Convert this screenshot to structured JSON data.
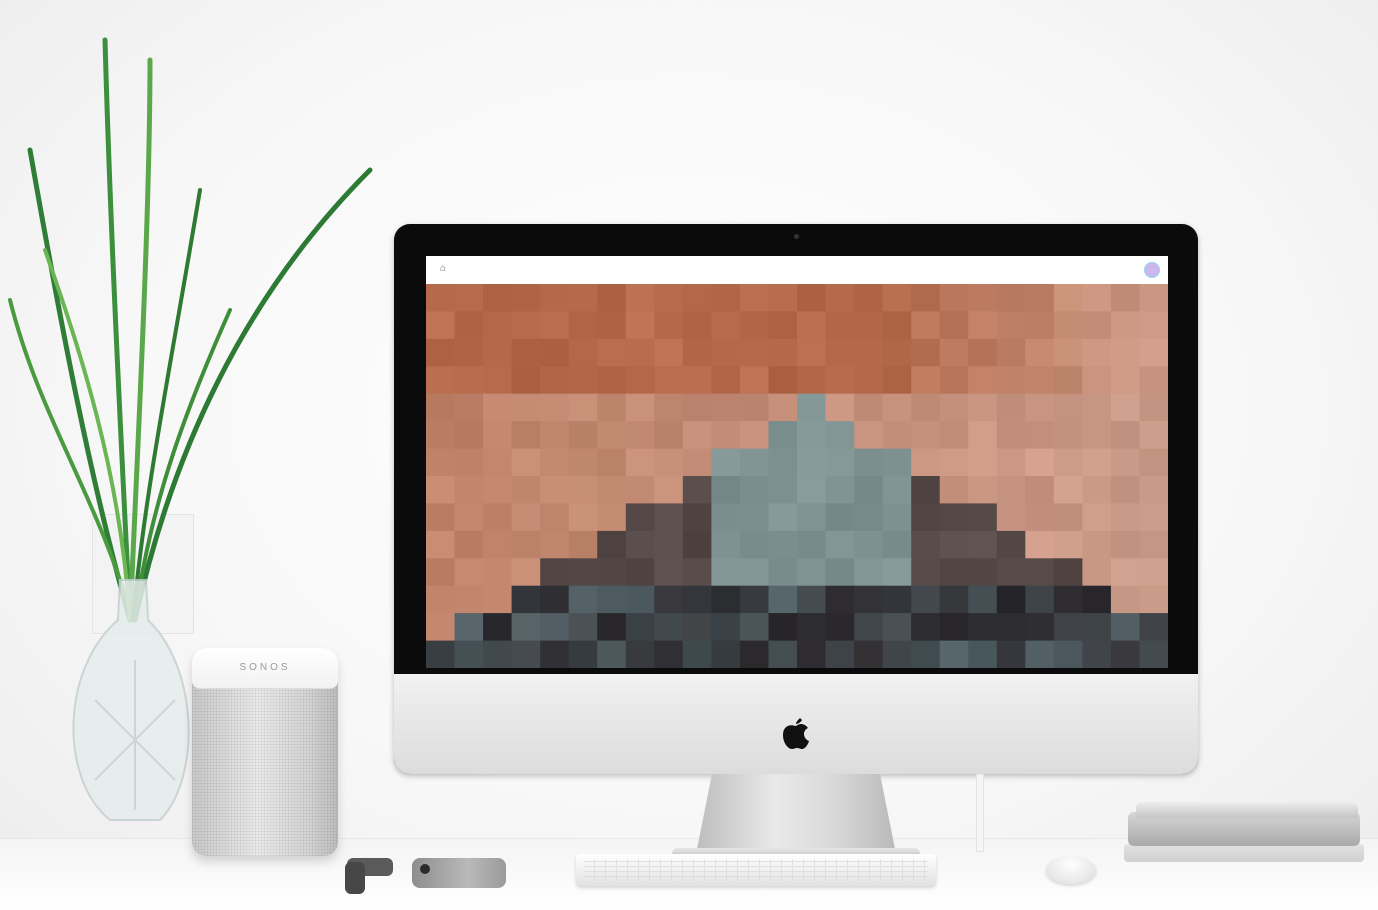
{
  "scene": {
    "speaker_brand": "SONOS"
  },
  "screen": {
    "navbar": {
      "logo_icon": "logo-icon",
      "links": [
        {
          "label": "",
          "active": true
        },
        {
          "label": ""
        },
        {
          "label": ""
        },
        {
          "label": ""
        },
        {
          "label": ""
        },
        {
          "label": ""
        },
        {
          "label": ""
        }
      ],
      "right_label": "",
      "badge_icon": "user-avatar-icon"
    },
    "hero": {
      "description": ""
    }
  },
  "colors": {
    "accent": "#4aa3c9",
    "hero_sky": "#b46a4b",
    "hero_rock": "#7f9292",
    "hero_dark": "#2d2a2e"
  }
}
